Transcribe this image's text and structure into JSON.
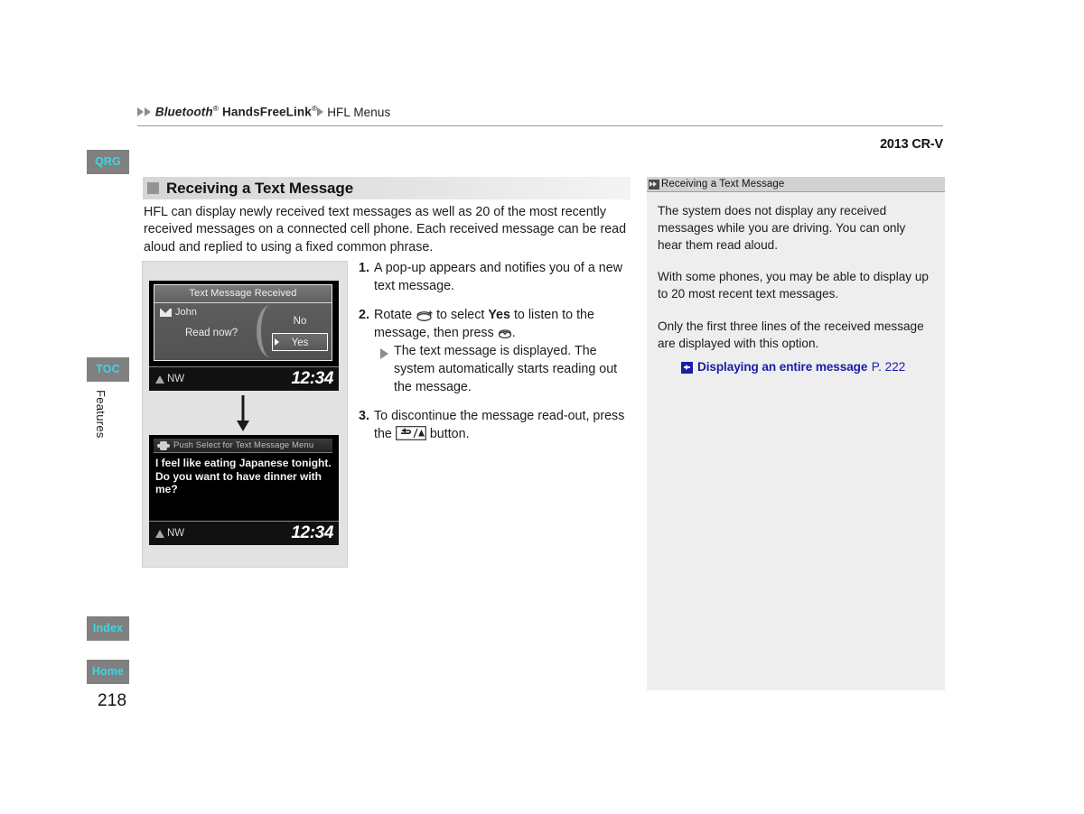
{
  "breadcrumb": {
    "item1": "Bluetooth",
    "item1_sup": "®",
    "item2": "HandsFreeLink",
    "item2_sup": "®",
    "item3": "HFL Menus"
  },
  "header": {
    "model_year": "2013 CR-V"
  },
  "sidebar": {
    "tabs": [
      {
        "label": "QRG"
      },
      {
        "label": "TOC"
      },
      {
        "label": "Index"
      },
      {
        "label": "Home"
      }
    ],
    "section_label": "Features",
    "page_number": "218",
    "tab_bg": "#808080",
    "tab_fg": "#3ad7e4"
  },
  "section": {
    "title": "Receiving a Text Message",
    "intro": "HFL can display newly received text messages as well as 20 of the most recently received messages on a connected cell phone. Each received message can be read aloud and replied to using a fixed common phrase."
  },
  "figure": {
    "screen1": {
      "popup_title": "Text Message Received",
      "sender": "John",
      "question": "Read now?",
      "button_no": "No",
      "button_yes": "Yes",
      "compass": "NW",
      "clock": "12:34"
    },
    "screen2": {
      "title": "Push Select for Text Message Menu",
      "message": "I feel like eating Japanese tonight. Do you want to have dinner with me?",
      "compass": "NW",
      "clock": "12:34"
    }
  },
  "steps": [
    {
      "num": "1.",
      "text": "A pop-up appears and notifies you of a new text message."
    },
    {
      "num": "2.",
      "text_a": "Rotate ",
      "text_b": " to select ",
      "bold": "Yes",
      "text_c": " to listen to the message, then press ",
      "text_d": ".",
      "substep": "The text message is displayed. The system automatically starts reading out the message."
    },
    {
      "num": "3.",
      "text_a": "To discontinue the message read-out, press the ",
      "text_b": " button."
    }
  ],
  "info_panel": {
    "header_title": "Receiving a Text Message",
    "paragraphs": [
      "The system does not display any received messages while you are driving. You can only hear them read aloud.",
      "With some phones, you may be able to display up to 20 most recent text messages.",
      "Only the first three lines of the received message are displayed with this option."
    ],
    "link_text": "Displaying an entire message",
    "link_page": "P. 222",
    "link_color": "#1c1ca8"
  }
}
